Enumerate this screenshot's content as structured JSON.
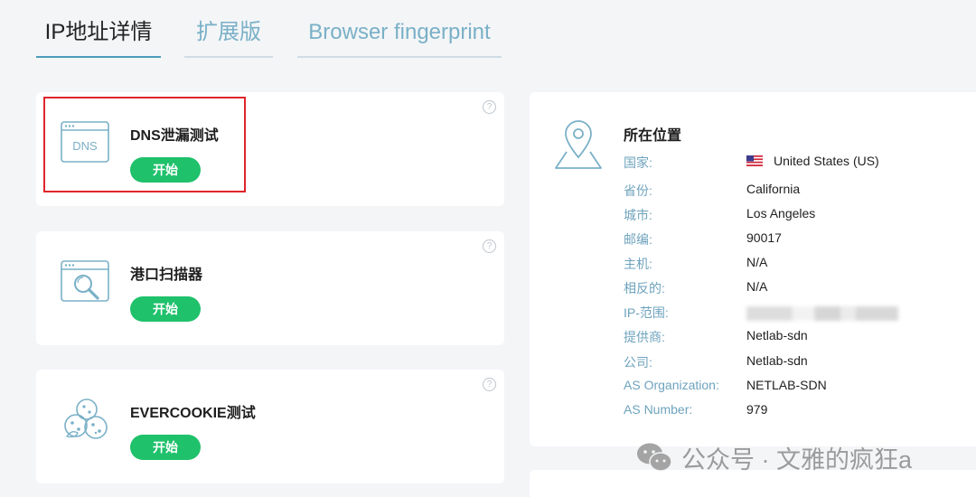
{
  "tabs": [
    {
      "label": "IP地址详情",
      "active": true
    },
    {
      "label": "扩展版",
      "active": false
    },
    {
      "label": "Browser fingerprint",
      "active": false
    }
  ],
  "tools": [
    {
      "icon": "dns-window-icon",
      "icon_text": "DNS",
      "title": "DNS泄漏测试",
      "button": "开始",
      "help": "?"
    },
    {
      "icon": "port-scan-icon",
      "title": "港口扫描器",
      "button": "开始",
      "help": "?"
    },
    {
      "icon": "cookie-icon",
      "title": "EVERCOOKIE测试",
      "button": "开始",
      "help": "?"
    }
  ],
  "location": {
    "icon": "map-pin-icon",
    "title": "所在位置",
    "rows": [
      {
        "label": "国家:",
        "value": "United States (US)",
        "flag": "us-flag-icon"
      },
      {
        "label": "省份:",
        "value": "California"
      },
      {
        "label": "城市:",
        "value": "Los Angeles"
      },
      {
        "label": "邮编:",
        "value": "90017"
      },
      {
        "label": "主机:",
        "value": "N/A"
      },
      {
        "label": "相反的:",
        "value": "N/A"
      },
      {
        "label": "IP-范围:",
        "value": "",
        "blurred": true
      },
      {
        "label": "提供商:",
        "value": "Netlab-sdn"
      },
      {
        "label": "公司:",
        "value": "Netlab-sdn"
      },
      {
        "label": "AS Organization:",
        "value": "NETLAB-SDN"
      },
      {
        "label": "AS Number:",
        "value": "979"
      }
    ]
  },
  "watermark": {
    "text": "公众号 · 文雅的疯狂a",
    "icon": "wechat-icon"
  },
  "colors": {
    "accent_green": "#1fc16b",
    "tab_underline": "#4d9bbb",
    "label_blue": "#6ea3bd",
    "highlight_red": "#e0242b"
  }
}
